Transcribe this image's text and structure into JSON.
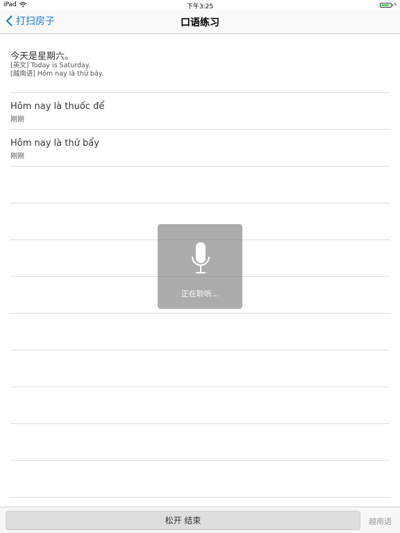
{
  "status_bar": {
    "device": "iPad",
    "time": "下午3:25",
    "battery_level": 0.8
  },
  "nav": {
    "back_label": "打扫房子",
    "title": "口语练习"
  },
  "entries": [
    {
      "sentence": "今天是星期六。",
      "english": "[英文] Today is Saturday.",
      "vietnamese": "[越南语] Hôm nay là thứ bảy."
    },
    {
      "sentence": "Hôm nay là thuốc để",
      "time": "刚刚"
    },
    {
      "sentence": "Hôm nay là thứ bẩy",
      "time": "刚刚"
    }
  ],
  "overlay": {
    "label": "正在聆听..."
  },
  "bottom": {
    "hold_label": "松开 结束",
    "language_label": "越南语"
  },
  "colors": {
    "accent": "#1a7bd6",
    "battery": "#4cd964"
  }
}
